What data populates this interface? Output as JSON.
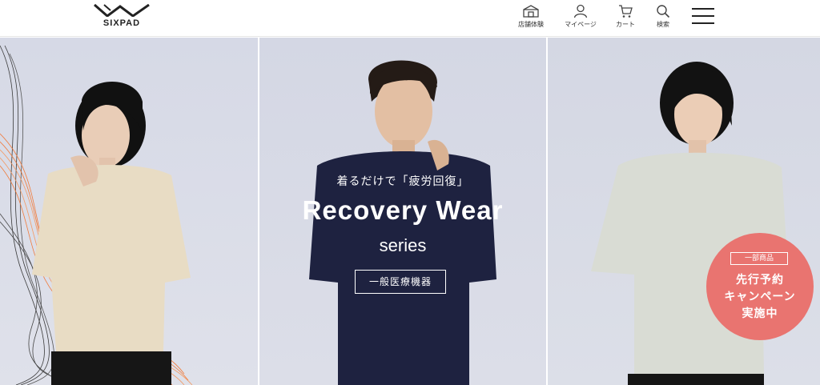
{
  "header": {
    "logo_text": "SIXPAD",
    "nav": [
      {
        "label": "店舗体験",
        "icon": "store-icon"
      },
      {
        "label": "マイページ",
        "icon": "user-icon"
      },
      {
        "label": "カート",
        "icon": "cart-icon"
      },
      {
        "label": "検索",
        "icon": "search-icon"
      }
    ],
    "menu_icon": "hamburger-icon"
  },
  "hero": {
    "tagline": "着るだけで「疲労回復」",
    "wordmark": "Recovery Wear",
    "series": "series",
    "device_badge": "一般医療機器",
    "promo": {
      "tag": "一部商品",
      "line1": "先行予約",
      "line2": "キャンペーン",
      "line3": "実施中"
    }
  },
  "colors": {
    "promo_badge": "#e97470",
    "hero_background": "#d8dbe6",
    "center_shirt": "#1e2240",
    "left_shirt": "#e8dcc4",
    "right_shirt": "#d9dcd4"
  }
}
